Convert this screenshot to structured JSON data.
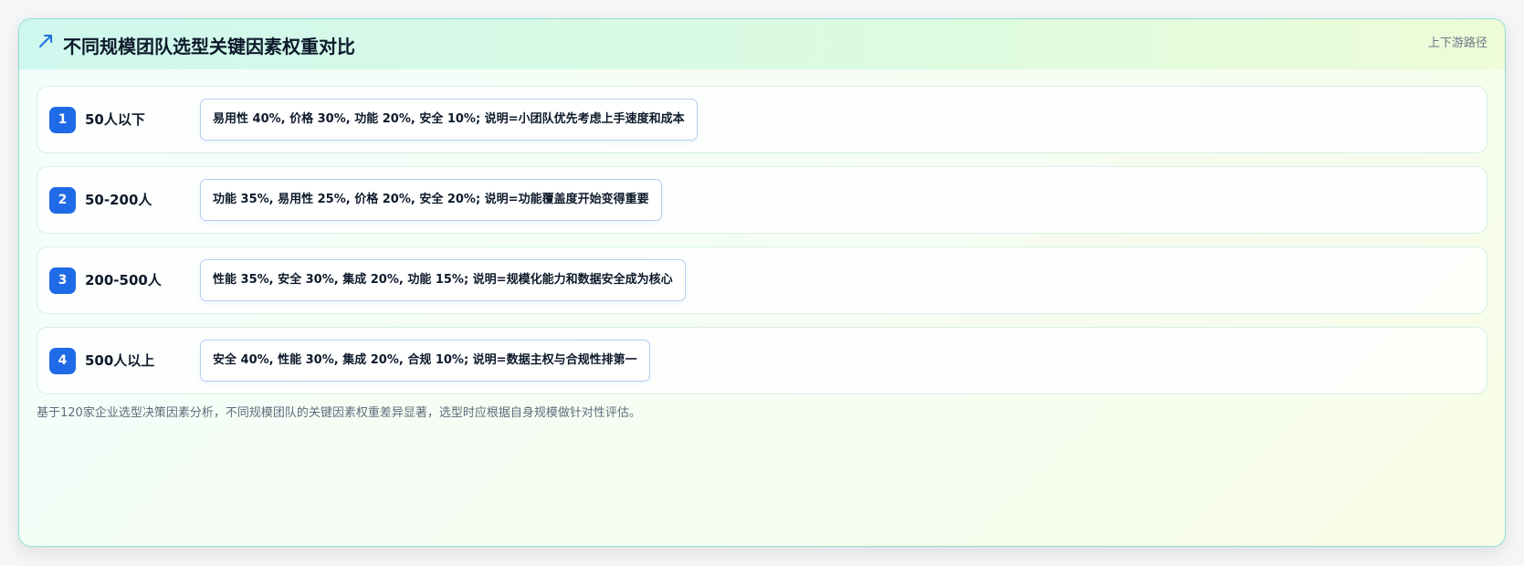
{
  "header": {
    "icon": "trend-up-arrow-icon",
    "title": "不同规模团队选型关键因素权重对比",
    "tag": "上下游路径"
  },
  "rows": [
    {
      "index": "1",
      "label": "50人以下",
      "weights": "易用性 40%, 价格 30%, 功能 20%, 安全 10%; 说明=小团队优先考虑上手速度和成本"
    },
    {
      "index": "2",
      "label": "50-200人",
      "weights": "功能 35%, 易用性 25%, 价格 20%, 安全 20%; 说明=功能覆盖度开始变得重要"
    },
    {
      "index": "3",
      "label": "200-500人",
      "weights": "性能 35%, 安全 30%, 集成 20%, 功能 15%; 说明=规模化能力和数据安全成为核心"
    },
    {
      "index": "4",
      "label": "500人以上",
      "weights": "安全 40%, 性能 30%, 集成 20%, 合规 10%; 说明=数据主权与合规性排第一"
    }
  ],
  "footnote": "基于120家企业选型决策因素分析，不同规模团队的关键因素权重差异显著，选型时应根据自身规模做针对性评估。",
  "colors": {
    "accent": "#1f6ae6",
    "border": "#8fe0d2",
    "title_text": "#0d1a2b",
    "muted_text": "#6b7785"
  }
}
